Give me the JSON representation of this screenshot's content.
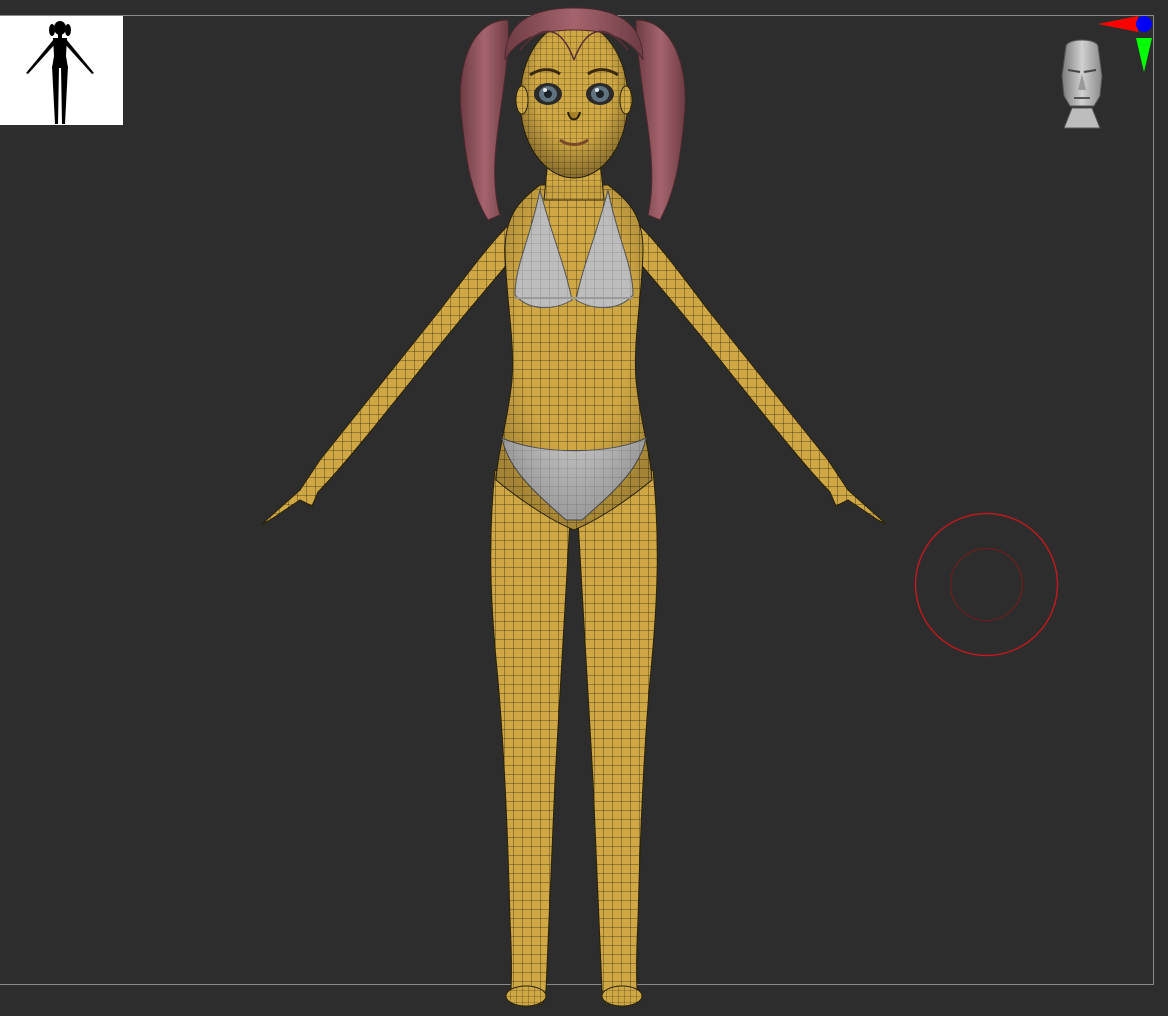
{
  "colors": {
    "viewport_bg": "#2d2d2d",
    "skin": "#cfa744",
    "skin_shadow": "#a8822b",
    "wire": "#3a2f12",
    "cloth": "#bcbcbc",
    "hair": "#9b5a63",
    "hair_dark": "#6e3c44",
    "brush_ring": "#c4181c",
    "axis_x": "#ff0000",
    "axis_y": "#00ff00",
    "axis_z": "#0000ff"
  },
  "icons": {
    "thumbnail": "figure-silhouette-icon",
    "gizmo": "axis-gizmo-icon",
    "head": "navigation-head-icon",
    "brush": "brush-cursor-icon"
  }
}
